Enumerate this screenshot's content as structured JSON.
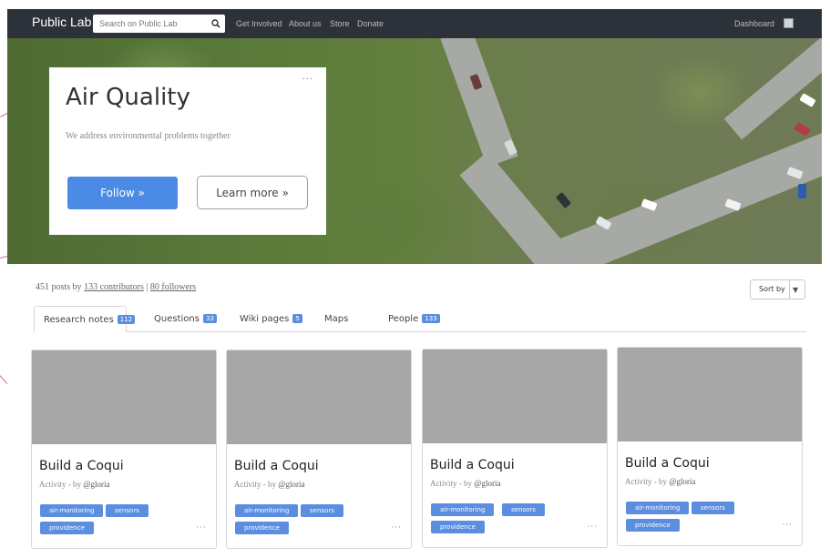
{
  "navbar": {
    "brand": "Public Lab",
    "search_placeholder": "Search on Public Lab",
    "links": [
      "Get Involved",
      "About us",
      "Store",
      "Donate"
    ],
    "dashboard": "Dashboard"
  },
  "hero": {
    "title": "Air Quality",
    "subtitle": "We address environmental problems together",
    "follow_label": "Follow »",
    "learn_label": "Learn more »",
    "more": "···"
  },
  "stats": {
    "posts": "451 posts by",
    "contributors": "133 contributors",
    "sep": "|",
    "followers": "80 followers"
  },
  "sort_label": "Sort by",
  "tabs": [
    {
      "label": "Research notes",
      "count": "112"
    },
    {
      "label": "Questions",
      "count": "33"
    },
    {
      "label": "Wiki pages",
      "count": "5"
    },
    {
      "label": "Maps",
      "count": ""
    },
    {
      "label": "People",
      "count": "133"
    }
  ],
  "cards": [
    {
      "title": "Build a Coqui",
      "meta_prefix": "Activity - by",
      "author": "@gloria",
      "tags": [
        "air-monitoring",
        "sensors",
        "providence"
      ],
      "more": "···"
    },
    {
      "title": "Build a Coqui",
      "meta_prefix": "Activity - by",
      "author": "@gloria",
      "tags": [
        "air-monitoring",
        "sensors",
        "providence"
      ],
      "more": "···"
    },
    {
      "title": "Build a Coqui",
      "meta_prefix": "Activity - by",
      "author": "@gloria",
      "tags": [
        "air-monitoring",
        "sensors",
        "providence"
      ],
      "more": "···"
    },
    {
      "title": "Build a Coqui",
      "meta_prefix": "Activity - by",
      "author": "@gloria",
      "tags": [
        "air-monitoring",
        "sensors",
        "providence"
      ],
      "more": "···"
    }
  ],
  "colors": {
    "navbar": "#2d3139",
    "accent": "#4b8be6",
    "tag": "#5b8ee0",
    "placeholder_image": "#a7a7a7"
  }
}
